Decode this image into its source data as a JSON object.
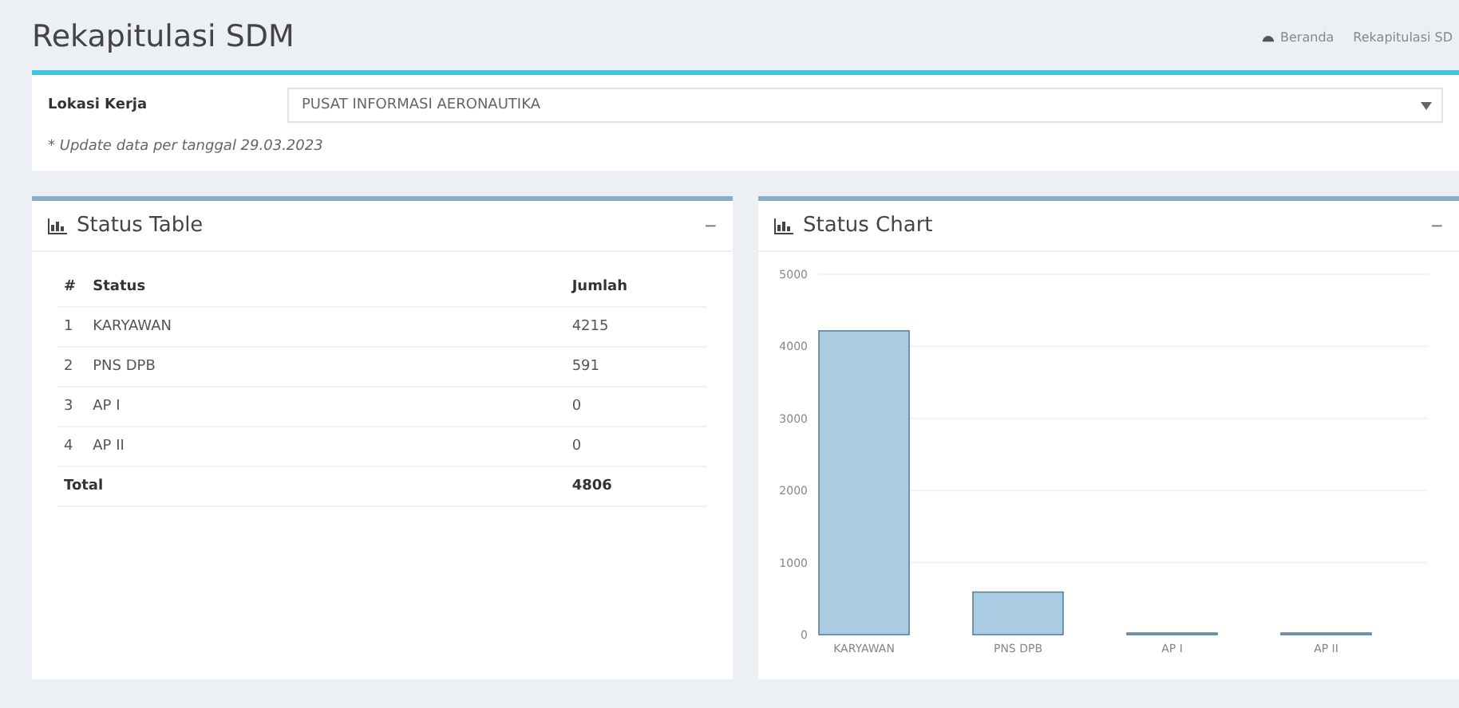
{
  "page": {
    "title": "Rekapitulasi SDM",
    "breadcrumb": [
      "Beranda",
      "Rekapitulasi SD"
    ]
  },
  "filter": {
    "label": "Lokasi Kerja",
    "value": "PUSAT INFORMASI AERONAUTIKA",
    "note": "* Update data per tanggal 29.03.2023"
  },
  "status_table": {
    "title": "Status Table",
    "collapse": "−",
    "columns": [
      "#",
      "Status",
      "Jumlah"
    ],
    "rows": [
      [
        "1",
        "KARYAWAN",
        "4215"
      ],
      [
        "2",
        "PNS DPB",
        "591"
      ],
      [
        "3",
        "AP I",
        "0"
      ],
      [
        "4",
        "AP II",
        "0"
      ]
    ],
    "total": {
      "label": "Total",
      "value": "4806"
    }
  },
  "status_chart": {
    "title": "Status Chart",
    "collapse": "−",
    "chart_data": {
      "type": "bar",
      "categories": [
        "KARYAWAN",
        "PNS DPB",
        "AP I",
        "AP II"
      ],
      "series": [
        {
          "color": "#a9cce3",
          "values": [
            4215,
            591,
            0,
            0
          ]
        }
      ],
      "grid": true,
      "ylim": [
        0,
        5000
      ],
      "yticks": [
        0,
        1000,
        2000,
        3000,
        4000,
        5000
      ]
    }
  }
}
